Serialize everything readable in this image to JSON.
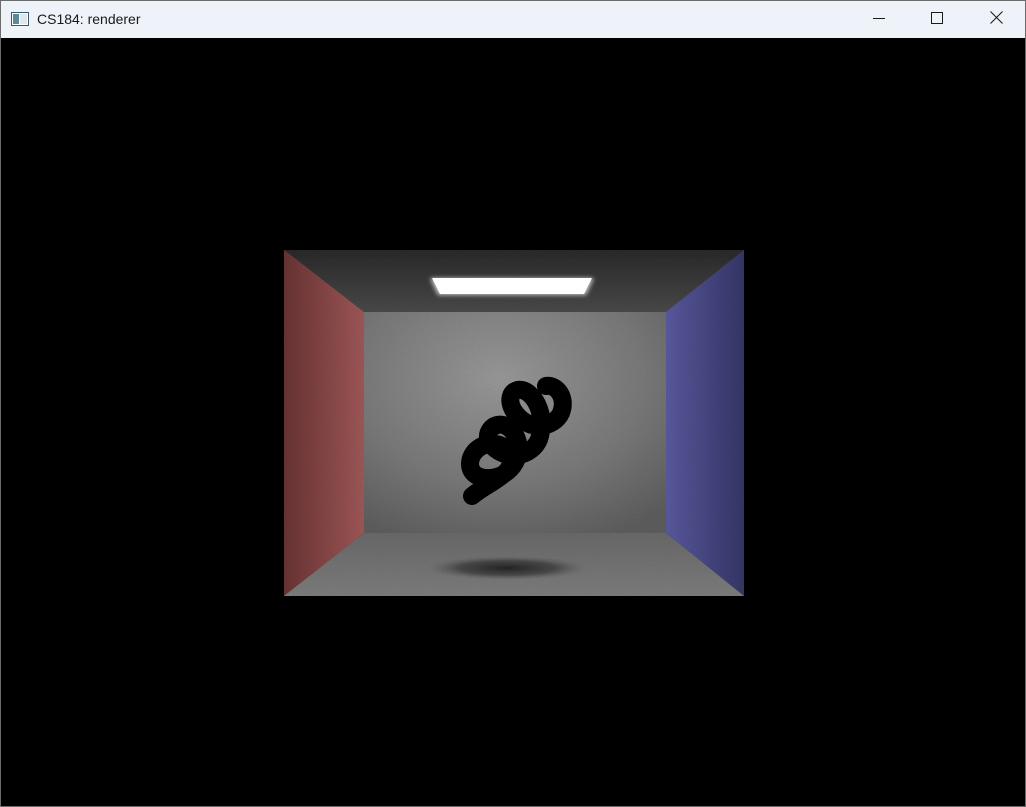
{
  "window": {
    "title": "CS184: renderer",
    "icons": {
      "app": "app-window-icon",
      "minimize": "minimize-icon",
      "maximize": "maximize-icon",
      "close": "close-icon"
    }
  },
  "scene": {
    "colors": {
      "background": "#000000",
      "left_wall": "#8a4a4a",
      "right_wall": "#4a4a8a",
      "back_wall": "#7c7c7c",
      "ceiling": "#3a3a3a",
      "floor": "#6e6e6e",
      "light": "#ffffff",
      "object": "#000000"
    }
  }
}
